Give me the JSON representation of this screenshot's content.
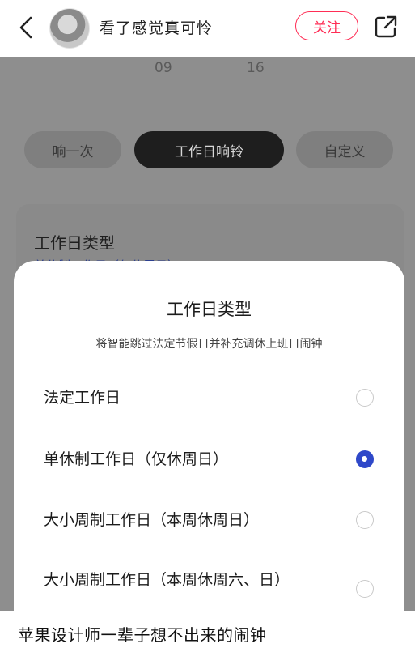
{
  "header": {
    "nickname": "看了感觉真可怜",
    "follow_label": "关注",
    "back_icon": "chevron-left-icon",
    "share_icon": "share-icon"
  },
  "screenshot": {
    "time_values": [
      "09",
      "16"
    ],
    "tabs": [
      {
        "label": "响一次",
        "active": false
      },
      {
        "label": "工作日响铃",
        "active": true
      },
      {
        "label": "自定义",
        "active": false
      }
    ],
    "card": {
      "title": "工作日类型",
      "subtitle": "单休制工作日（仅休周日）"
    },
    "sheet": {
      "title": "工作日类型",
      "description": "将智能跳过法定节假日并补充调休上班日闹钟",
      "options": [
        {
          "label": "法定工作日",
          "selected": false
        },
        {
          "label": "单休制工作日（仅休周日）",
          "selected": true
        },
        {
          "label": "大小周制工作日（本周休周日）",
          "selected": false
        },
        {
          "label": "大小周制工作日（本周休周六、日）",
          "selected": false
        }
      ]
    }
  },
  "caption": "苹果设计师一辈子想不出来的闹钟",
  "colors": {
    "accent_red": "#ff2d55",
    "radio_blue": "#2f48c9"
  }
}
